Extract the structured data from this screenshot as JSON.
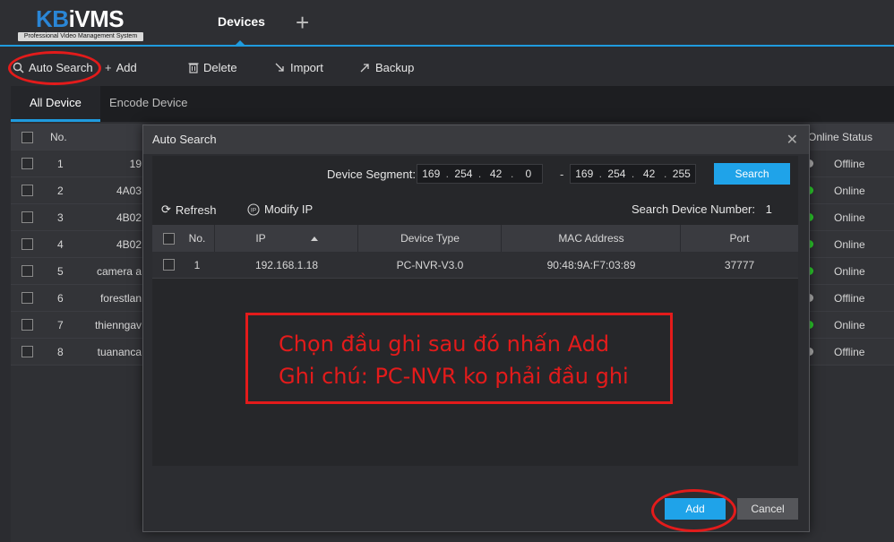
{
  "app": {
    "logo_main": "KBiVMS",
    "logo_sub": "Professional Video Management System",
    "tab_devices": "Devices",
    "tab_add": "+"
  },
  "toolbar": {
    "auto_search": "Auto Search",
    "add": "Add",
    "delete": "Delete",
    "import": "Import",
    "backup": "Backup"
  },
  "subtabs": {
    "all_device": "All Device",
    "encode_device": "Encode Device"
  },
  "device_table": {
    "col_no": "No.",
    "col_online_status": "Online Status",
    "rows": [
      {
        "no": "1",
        "name": "19",
        "status": "Offline",
        "status_color": "#b5b5b5"
      },
      {
        "no": "2",
        "name": "4A03",
        "status": "Online",
        "status_color": "#2ed62e"
      },
      {
        "no": "3",
        "name": "4B02",
        "status": "Online",
        "status_color": "#2ed62e"
      },
      {
        "no": "4",
        "name": "4B02",
        "status": "Online",
        "status_color": "#2ed62e"
      },
      {
        "no": "5",
        "name": "camera a",
        "status": "Online",
        "status_color": "#2ed62e"
      },
      {
        "no": "6",
        "name": "forestlan",
        "status": "Offline",
        "status_color": "#b5b5b5"
      },
      {
        "no": "7",
        "name": "thienngav",
        "status": "Online",
        "status_color": "#2ed62e"
      },
      {
        "no": "8",
        "name": "tuananca",
        "status": "Offline",
        "status_color": "#b5b5b5"
      }
    ]
  },
  "dialog": {
    "title": "Auto Search",
    "segment_label": "Device Segment:",
    "start_ip": [
      "169",
      "254",
      "42",
      "0"
    ],
    "end_ip": [
      "169",
      "254",
      "42",
      "255"
    ],
    "search_button": "Search",
    "refresh": "Refresh",
    "modify_ip": "Modify IP",
    "search_count_label": "Search Device Number:",
    "search_count": "1",
    "columns": {
      "no": "No.",
      "ip": "IP",
      "device_type": "Device Type",
      "mac": "MAC Address",
      "port": "Port"
    },
    "results": [
      {
        "no": "1",
        "ip": "192.168.1.18",
        "device_type": "PC-NVR-V3.0",
        "mac": "90:48:9A:F7:03:89",
        "port": "37777"
      }
    ],
    "add_button": "Add",
    "cancel_button": "Cancel"
  },
  "annotation": {
    "line1": "Chọn đầu ghi sau đó nhấn Add",
    "line2": "Ghi chú: PC-NVR ko phải đầu ghi",
    "color": "#e31b1b"
  },
  "colors": {
    "accent": "#1f9bde",
    "button_blue": "#1fa3e9",
    "online": "#2ed62e",
    "offline": "#b5b5b5"
  }
}
